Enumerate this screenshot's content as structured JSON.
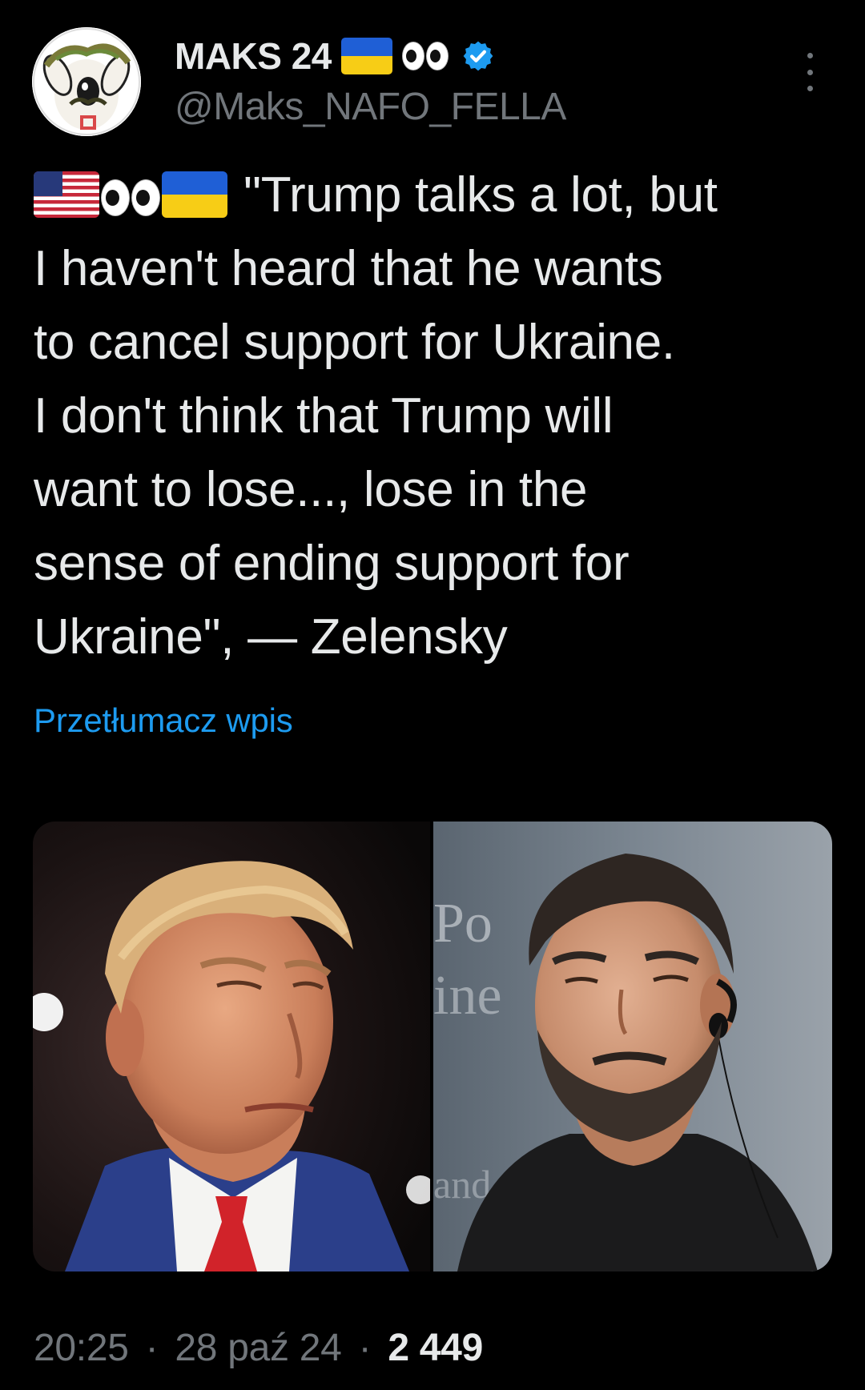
{
  "author": {
    "display_name": "MAKS 24",
    "handle": "@Maks_NAFO_FELLA",
    "avatar_icon": "nafo-fella-avatar",
    "verified_icon": "verified-badge-icon",
    "name_emojis": [
      "ukraine-flag-icon",
      "eyes-icon"
    ]
  },
  "tweet": {
    "leading_emojis": [
      "usa-flag-icon",
      "eyes-icon",
      "ukraine-flag-icon"
    ],
    "lines": [
      "\"Trump talks a lot, but",
      "I haven't heard that he wants",
      "to cancel support for Ukraine.",
      "I don't think that Trump will",
      "want to lose..., lose in the",
      "sense of ending support for",
      "Ukraine\", — Zelensky"
    ],
    "translate_label": "Przetłumacz wpis"
  },
  "media": {
    "left_photo": "trump-photo",
    "right_photo": "zelensky-photo"
  },
  "meta": {
    "time": "20:25",
    "date": "28 paź 24",
    "separator": "·",
    "views": "2 449"
  },
  "colors": {
    "background": "#000000",
    "text": "#e7e9ea",
    "secondary": "#71767b",
    "link": "#1d9bf0",
    "verified": "#1d9bf0"
  }
}
